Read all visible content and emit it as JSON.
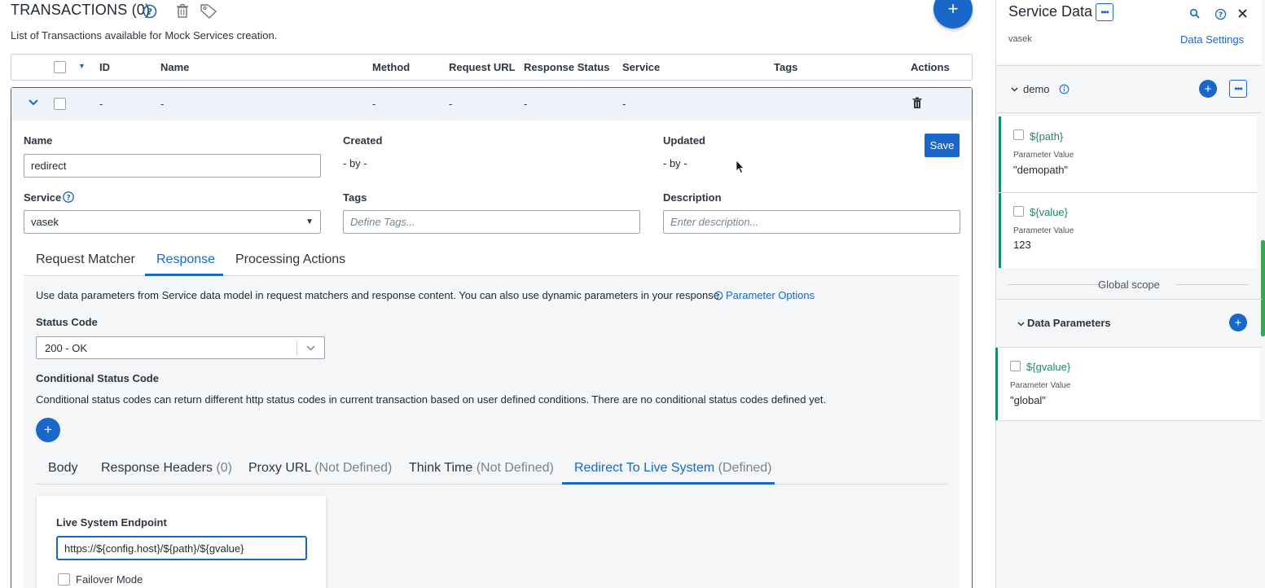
{
  "header": {
    "title": "TRANSACTIONS (0)",
    "subtitle": "List of Transactions available for Mock Services creation.",
    "add_label": "+"
  },
  "table": {
    "columns": [
      "ID",
      "Name",
      "Method",
      "Request URL",
      "Response Status",
      "Service",
      "Tags",
      "Actions"
    ],
    "row": [
      "-",
      "-",
      "-",
      "-",
      "-",
      "-"
    ]
  },
  "form": {
    "name_label": "Name",
    "name_value": "redirect",
    "created_label": "Created",
    "created_value": "- by -",
    "updated_label": "Updated",
    "updated_value": "- by -",
    "save_label": "Save",
    "service_label": "Service",
    "service_value": "vasek",
    "tags_label": "Tags",
    "tags_placeholder": "Define Tags...",
    "description_label": "Description",
    "description_placeholder": "Enter description..."
  },
  "tabs": {
    "request_matcher": "Request Matcher",
    "response": "Response",
    "processing_actions": "Processing Actions"
  },
  "response": {
    "info": "Use data parameters from Service data model in request matchers and response content. You can also use dynamic parameters in your response.",
    "parameter_options": "Parameter Options",
    "status_code_label": "Status Code",
    "status_code_value": "200 - OK",
    "conditional_label": "Conditional Status Code",
    "conditional_text": "Conditional status codes can return different http status codes in current transaction based on user defined conditions. There are no conditional status codes defined yet.",
    "add_label": "+"
  },
  "subtabs": {
    "body": "Body",
    "headers": "Response Headers",
    "headers_count": "(0)",
    "proxy": "Proxy URL",
    "proxy_state": "(Not Defined)",
    "think": "Think Time",
    "think_state": "(Not Defined)",
    "redirect": "Redirect To Live System",
    "redirect_state": "(Defined)"
  },
  "endpoint": {
    "label": "Live System Endpoint",
    "value": "https://${config.host}/${path}/${gvalue}",
    "failover_label": "Failover Mode"
  },
  "side": {
    "title": "Service Data",
    "service_name": "vasek",
    "data_settings": "Data Settings",
    "scope_name": "demo",
    "params": [
      {
        "name": "${path}",
        "label": "Parameter Value",
        "value": "\"demopath\""
      },
      {
        "name": "${value}",
        "label": "Parameter Value",
        "value": "123"
      }
    ],
    "global_scope": "Global scope",
    "data_parameters": "Data Parameters",
    "global_params": [
      {
        "name": "${gvalue}",
        "label": "Parameter Value",
        "value": "\"global\""
      }
    ]
  },
  "colors": {
    "accent": "#1967c9",
    "param_green": "#1a8a6e",
    "scrollbar_green": "#3aa655"
  }
}
